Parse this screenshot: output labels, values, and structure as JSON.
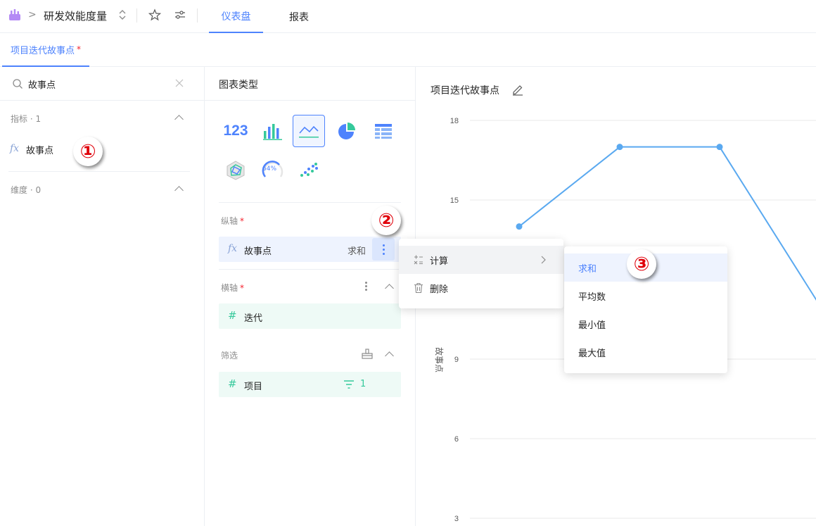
{
  "topbar": {
    "app_icon": "app-logo-icon",
    "breadcrumb_separator": ">",
    "title": "研发效能度量",
    "tabs": [
      {
        "label": "仪表盘",
        "active": true
      },
      {
        "label": "报表",
        "active": false
      }
    ]
  },
  "chart_tab": {
    "label": "项目迭代故事点",
    "required_mark": "*"
  },
  "left": {
    "search": {
      "value": "故事点"
    },
    "metrics_header": "指标 · 1",
    "metric_item": {
      "prefix": "fx",
      "label": "故事点"
    },
    "dimensions_header": "维度 · 0"
  },
  "mid": {
    "chart_type_title": "图表类型",
    "chart_types": [
      "number",
      "bar",
      "line",
      "pie",
      "table",
      "radar",
      "gauge",
      "scatter"
    ],
    "active_chart_type": "line",
    "gauge_text": "64%",
    "number_text": "123",
    "y_axis": {
      "label": "纵轴",
      "required": "*",
      "field": {
        "prefix": "fx",
        "label": "故事点",
        "agg": "求和"
      }
    },
    "x_axis": {
      "label": "横轴",
      "required": "*",
      "field": {
        "prefix": "#",
        "label": "迭代"
      }
    },
    "filter": {
      "label": "筛选",
      "field": {
        "prefix": "#",
        "label": "项目",
        "count": "1"
      }
    }
  },
  "context_menu": {
    "items": [
      {
        "icon": "calculate-icon",
        "label": "计算",
        "has_submenu": true
      },
      {
        "icon": "trash-icon",
        "label": "删除"
      }
    ]
  },
  "submenu": {
    "items": [
      "求和",
      "平均数",
      "最小值",
      "最大值"
    ],
    "selected": "求和"
  },
  "annotations": [
    "①",
    "②",
    "③"
  ],
  "chart": {
    "title": "项目迭代故事点"
  },
  "chart_data": {
    "type": "line",
    "ylabel": "故事点",
    "y_ticks": [
      3,
      6,
      9,
      15,
      18
    ],
    "ylim": [
      3,
      18
    ],
    "points": [
      {
        "x": 1,
        "y": 14
      },
      {
        "x": 2,
        "y": 17
      },
      {
        "x": 3,
        "y": 17
      },
      {
        "x": 4,
        "y": 11
      }
    ],
    "color": "#5aa9f0"
  },
  "colors": {
    "accent": "#4e83fd",
    "line": "#5aa9f0",
    "hash": "#35c99b"
  }
}
